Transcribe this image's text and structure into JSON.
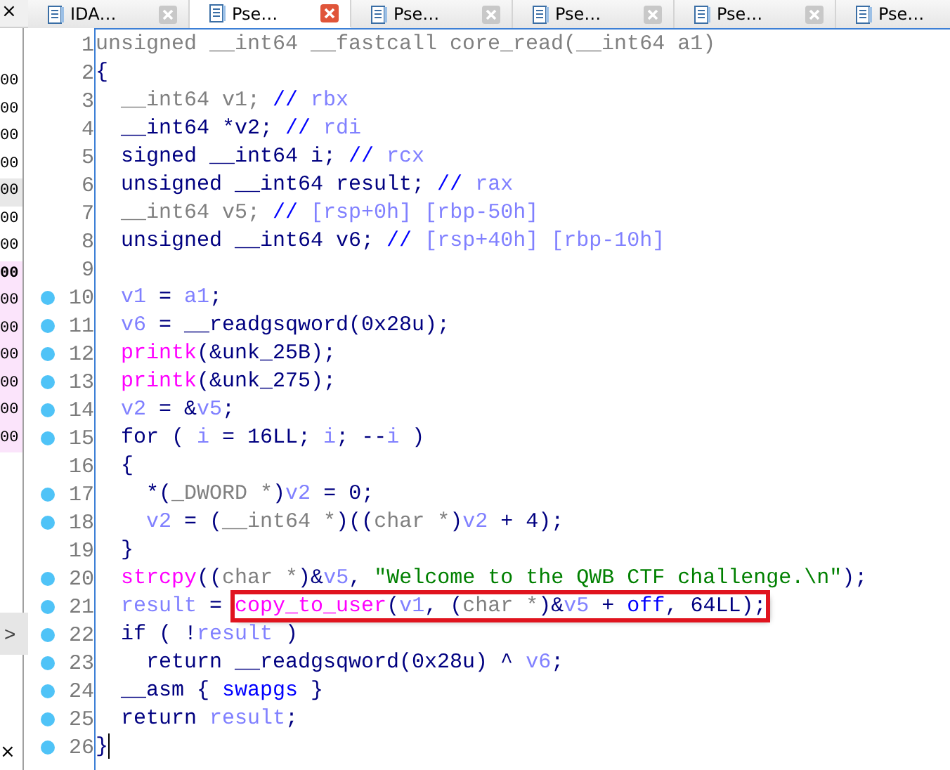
{
  "side_panel": {
    "close": "×",
    "rows": [
      {
        "text": "00",
        "kind": "plain"
      },
      {
        "text": "00",
        "kind": "plain"
      },
      {
        "text": "00",
        "kind": "plain"
      },
      {
        "text": "00",
        "kind": "plain"
      },
      {
        "text": "00",
        "kind": "current"
      },
      {
        "text": "00",
        "kind": "plain"
      },
      {
        "text": "00",
        "kind": "plain"
      },
      {
        "text": "00",
        "kind": "marked_bold"
      },
      {
        "text": "00",
        "kind": "marked"
      },
      {
        "text": "00",
        "kind": "marked"
      },
      {
        "text": "00",
        "kind": "marked"
      },
      {
        "text": "00",
        "kind": "marked"
      },
      {
        "text": "00",
        "kind": "marked"
      },
      {
        "text": "00",
        "kind": "marked"
      }
    ],
    "expand": ">",
    "bottom_close": "×"
  },
  "tabs": [
    {
      "label": "IDA…",
      "selected": false
    },
    {
      "label": "Pse…",
      "selected": true
    },
    {
      "label": "Pse…",
      "selected": false
    },
    {
      "label": "Pse…",
      "selected": false
    },
    {
      "label": "Pse…",
      "selected": false
    },
    {
      "label": "Pse…",
      "selected": false
    }
  ],
  "lines": [
    {
      "number": "1",
      "breakpoint": false,
      "cursor": false,
      "tokens": [
        {
          "kind": "gray",
          "text": "unsigned __int64 __fastcall core_read(__int64 a1)"
        }
      ]
    },
    {
      "number": "2",
      "breakpoint": false,
      "cursor": false,
      "tokens": [
        {
          "kind": "plain",
          "text": "{"
        }
      ]
    },
    {
      "number": "3",
      "breakpoint": false,
      "cursor": false,
      "tokens": [
        {
          "kind": "gray",
          "text": "  __int64 v1; "
        },
        {
          "kind": "slash",
          "text": "// "
        },
        {
          "kind": "comment",
          "text": "rbx"
        }
      ]
    },
    {
      "number": "4",
      "breakpoint": false,
      "cursor": false,
      "tokens": [
        {
          "kind": "plain",
          "text": "  __int64 *v2; "
        },
        {
          "kind": "slash",
          "text": "// "
        },
        {
          "kind": "comment",
          "text": "rdi"
        }
      ]
    },
    {
      "number": "5",
      "breakpoint": false,
      "cursor": false,
      "tokens": [
        {
          "kind": "plain",
          "text": "  signed __int64 i; "
        },
        {
          "kind": "slash",
          "text": "// "
        },
        {
          "kind": "comment",
          "text": "rcx"
        }
      ]
    },
    {
      "number": "6",
      "breakpoint": false,
      "cursor": false,
      "tokens": [
        {
          "kind": "plain",
          "text": "  unsigned __int64 result; "
        },
        {
          "kind": "slash",
          "text": "// "
        },
        {
          "kind": "comment",
          "text": "rax"
        }
      ]
    },
    {
      "number": "7",
      "breakpoint": false,
      "cursor": false,
      "tokens": [
        {
          "kind": "gray",
          "text": "  __int64 v5; "
        },
        {
          "kind": "slash",
          "text": "// "
        },
        {
          "kind": "comment",
          "text": "[rsp+0h] [rbp-50h]"
        }
      ]
    },
    {
      "number": "8",
      "breakpoint": false,
      "cursor": false,
      "tokens": [
        {
          "kind": "plain",
          "text": "  unsigned __int64 v6; "
        },
        {
          "kind": "slash",
          "text": "// "
        },
        {
          "kind": "comment",
          "text": "[rsp+40h] [rbp-10h]"
        }
      ]
    },
    {
      "number": "9",
      "breakpoint": false,
      "cursor": false
    },
    {
      "number": "10",
      "breakpoint": true,
      "cursor": false,
      "tokens": [
        {
          "kind": "var",
          "text": "  v1"
        },
        {
          "kind": "plain",
          "text": " = "
        },
        {
          "kind": "var",
          "text": "a1"
        },
        {
          "kind": "plain",
          "text": ";"
        }
      ]
    },
    {
      "number": "11",
      "breakpoint": true,
      "cursor": false,
      "tokens": [
        {
          "kind": "var",
          "text": "  v6"
        },
        {
          "kind": "plain",
          "text": " = __readgsqword(0x28u);"
        }
      ]
    },
    {
      "number": "12",
      "breakpoint": true,
      "cursor": false,
      "tokens": [
        {
          "kind": "func",
          "text": "  printk"
        },
        {
          "kind": "plain",
          "text": "(&unk_25B);"
        }
      ]
    },
    {
      "number": "13",
      "breakpoint": true,
      "cursor": false,
      "tokens": [
        {
          "kind": "func",
          "text": "  printk"
        },
        {
          "kind": "plain",
          "text": "(&unk_275);"
        }
      ]
    },
    {
      "number": "14",
      "breakpoint": true,
      "cursor": false,
      "tokens": [
        {
          "kind": "var",
          "text": "  v2"
        },
        {
          "kind": "plain",
          "text": " = &"
        },
        {
          "kind": "var",
          "text": "v5"
        },
        {
          "kind": "plain",
          "text": ";"
        }
      ]
    },
    {
      "number": "15",
      "breakpoint": true,
      "cursor": false,
      "tokens": [
        {
          "kind": "plain",
          "text": "  for ( "
        },
        {
          "kind": "var",
          "text": "i"
        },
        {
          "kind": "plain",
          "text": " = 16LL; "
        },
        {
          "kind": "var",
          "text": "i"
        },
        {
          "kind": "plain",
          "text": "; --"
        },
        {
          "kind": "var",
          "text": "i"
        },
        {
          "kind": "plain",
          "text": " )"
        }
      ]
    },
    {
      "number": "16",
      "breakpoint": false,
      "cursor": false,
      "tokens": [
        {
          "kind": "plain",
          "text": "  {"
        }
      ]
    },
    {
      "number": "17",
      "breakpoint": true,
      "cursor": false,
      "tokens": [
        {
          "kind": "plain",
          "text": "    *("
        },
        {
          "kind": "gray",
          "text": "_DWORD *"
        },
        {
          "kind": "plain",
          "text": ")"
        },
        {
          "kind": "var",
          "text": "v2"
        },
        {
          "kind": "plain",
          "text": " = 0;"
        }
      ]
    },
    {
      "number": "18",
      "breakpoint": true,
      "cursor": false,
      "tokens": [
        {
          "kind": "var",
          "text": "    v2"
        },
        {
          "kind": "plain",
          "text": " = ("
        },
        {
          "kind": "gray",
          "text": "__int64 *"
        },
        {
          "kind": "plain",
          "text": ")(("
        },
        {
          "kind": "gray",
          "text": "char *"
        },
        {
          "kind": "plain",
          "text": ")"
        },
        {
          "kind": "var",
          "text": "v2"
        },
        {
          "kind": "plain",
          "text": " + 4);"
        }
      ]
    },
    {
      "number": "19",
      "breakpoint": false,
      "cursor": false,
      "tokens": [
        {
          "kind": "plain",
          "text": "  }"
        }
      ]
    },
    {
      "number": "20",
      "breakpoint": true,
      "cursor": false,
      "tokens": [
        {
          "kind": "func",
          "text": "  strcpy"
        },
        {
          "kind": "plain",
          "text": "(("
        },
        {
          "kind": "gray",
          "text": "char *"
        },
        {
          "kind": "plain",
          "text": ")&"
        },
        {
          "kind": "var",
          "text": "v5"
        },
        {
          "kind": "plain",
          "text": ", "
        },
        {
          "kind": "string",
          "text": "\"Welcome to the QWB CTF challenge.\\n\""
        },
        {
          "kind": "plain",
          "text": ");"
        }
      ]
    },
    {
      "number": "21",
      "breakpoint": true,
      "cursor": false,
      "tokens": [
        {
          "kind": "var",
          "text": "  result"
        },
        {
          "kind": "plain",
          "text": " = "
        }
      ],
      "boxed": [
        {
          "kind": "func",
          "text": "copy_to_user"
        },
        {
          "kind": "plain",
          "text": "("
        },
        {
          "kind": "var",
          "text": "v1"
        },
        {
          "kind": "plain",
          "text": ", ("
        },
        {
          "kind": "gray",
          "text": "char *"
        },
        {
          "kind": "plain",
          "text": ")&"
        },
        {
          "kind": "var",
          "text": "v5"
        },
        {
          "kind": "plain",
          "text": " + "
        },
        {
          "kind": "global",
          "text": "off"
        },
        {
          "kind": "plain",
          "text": ", 64LL);"
        }
      ]
    },
    {
      "number": "22",
      "breakpoint": true,
      "cursor": false,
      "tokens": [
        {
          "kind": "plain",
          "text": "  if ( !"
        },
        {
          "kind": "var",
          "text": "result"
        },
        {
          "kind": "plain",
          "text": " )"
        }
      ]
    },
    {
      "number": "23",
      "breakpoint": true,
      "cursor": false,
      "tokens": [
        {
          "kind": "plain",
          "text": "    return __readgsqword(0x28u) ^ "
        },
        {
          "kind": "var",
          "text": "v6"
        },
        {
          "kind": "plain",
          "text": ";"
        }
      ]
    },
    {
      "number": "24",
      "breakpoint": true,
      "cursor": false,
      "tokens": [
        {
          "kind": "plain",
          "text": "  __asm { "
        },
        {
          "kind": "global",
          "text": "swapgs"
        },
        {
          "kind": "plain",
          "text": " }"
        }
      ]
    },
    {
      "number": "25",
      "breakpoint": true,
      "cursor": false,
      "tokens": [
        {
          "kind": "plain",
          "text": "  return "
        },
        {
          "kind": "var",
          "text": "result"
        },
        {
          "kind": "plain",
          "text": ";"
        }
      ]
    },
    {
      "number": "26",
      "breakpoint": true,
      "cursor": true,
      "tokens": [
        {
          "kind": "plain",
          "text": "}"
        }
      ]
    }
  ]
}
